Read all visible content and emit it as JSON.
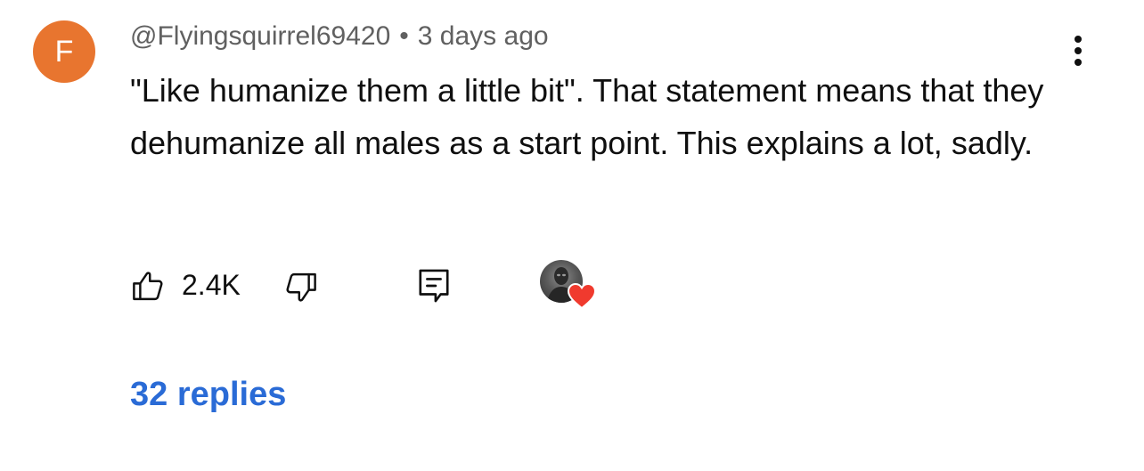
{
  "comment": {
    "avatar_letter": "F",
    "avatar_color": "#e8752f",
    "author": "@Flyingsquirrel69420",
    "separator": "•",
    "timestamp": "3 days ago",
    "text": "\"Like humanize them a little bit\". That statement means that they dehumanize all males as a start point. This explains a lot, sadly.",
    "likes": "2.4K",
    "hearted_by_creator": true,
    "heart_color": "#f03a2e",
    "replies_label": "32 replies",
    "replies_color": "#2a6bd6",
    "icons": {
      "more": "more-vert-icon",
      "like": "thumbs-up-icon",
      "dislike": "thumbs-down-icon",
      "reply": "reply-comment-icon",
      "heart": "heart-icon"
    }
  }
}
